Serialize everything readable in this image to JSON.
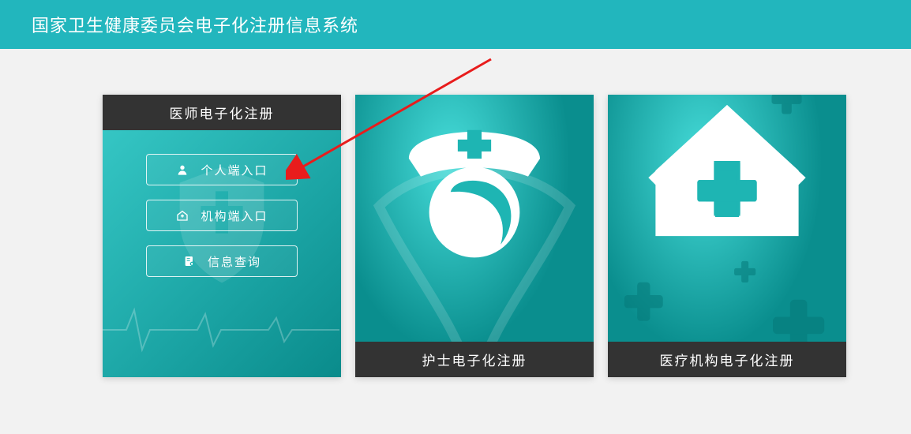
{
  "header": {
    "title": "国家卫生健康委员会电子化注册信息系统"
  },
  "cards": {
    "doctor": {
      "title": "医师电子化注册",
      "buttons": {
        "personal": "个人端入口",
        "org": "机构端入口",
        "query": "信息查询"
      }
    },
    "nurse": {
      "title": "护士电子化注册"
    },
    "medInst": {
      "title": "医疗机构电子化注册"
    }
  },
  "colors": {
    "teal": "#22b6bd",
    "teal_dark": "#0a8e8e",
    "title_bg": "#333333",
    "annotation": "#e81c1c"
  }
}
